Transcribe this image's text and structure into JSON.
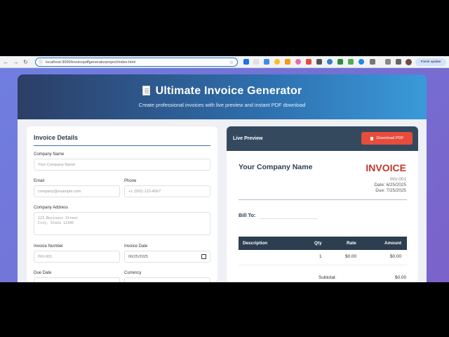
{
  "browser": {
    "url": "localhost:3000/invoicepdfgeneratorproject/index.html",
    "finish_update": "Finish update"
  },
  "header": {
    "title": "Ultimate Invoice Generator",
    "subtitle": "Create professional invoices with live preview and instant PDF download"
  },
  "form": {
    "section_title": "Invoice Details",
    "company_name": {
      "label": "Company Name",
      "placeholder": "Your Company Name"
    },
    "email": {
      "label": "Email",
      "placeholder": "company@example.com"
    },
    "phone": {
      "label": "Phone",
      "placeholder": "+1 (555) 123-4567"
    },
    "address": {
      "label": "Company Address",
      "placeholder_line1": "123 Business Street",
      "placeholder_line2": "City, State 12345"
    },
    "invoice_number": {
      "label": "Invoice Number",
      "placeholder": "INV-001"
    },
    "invoice_date": {
      "label": "Invoice Date",
      "value": "06/25/2025"
    },
    "due_date": {
      "label": "Due Date"
    },
    "currency": {
      "label": "Currency"
    }
  },
  "preview": {
    "title": "Live Preview",
    "download_label": "Download PDF",
    "company_name": "Your Company Name",
    "invoice_word": "INVOICE",
    "invoice_number": "INV-001",
    "date_line": "Date: 6/25/2025",
    "due_line": "Due: 7/25/2025",
    "bill_to": "Bill To:",
    "table": {
      "headers": [
        "Description",
        "Qty",
        "Rate",
        "Amount"
      ],
      "rows": [
        {
          "description": "",
          "qty": "1",
          "rate": "$0.00",
          "amount": "$0.00"
        }
      ]
    },
    "subtotal_label": "Subtotal:",
    "subtotal_value": "$0.00"
  },
  "colors": {
    "accent": "#34495e",
    "invoice_red": "#c0392b",
    "download_button": "#e74c3c"
  }
}
